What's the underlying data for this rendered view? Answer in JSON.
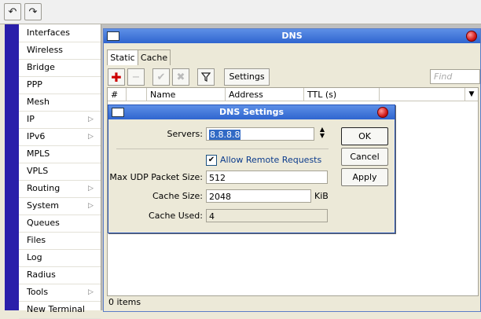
{
  "toolbar": {
    "undo_icon": "undo-icon",
    "redo_icon": "redo-icon"
  },
  "menu": {
    "items": [
      {
        "label": "Interfaces",
        "submenu": false
      },
      {
        "label": "Wireless",
        "submenu": false
      },
      {
        "label": "Bridge",
        "submenu": false
      },
      {
        "label": "PPP",
        "submenu": false
      },
      {
        "label": "Mesh",
        "submenu": false
      },
      {
        "label": "IP",
        "submenu": true
      },
      {
        "label": "IPv6",
        "submenu": true
      },
      {
        "label": "MPLS",
        "submenu": false
      },
      {
        "label": "VPLS",
        "submenu": false
      },
      {
        "label": "Routing",
        "submenu": true
      },
      {
        "label": "System",
        "submenu": true
      },
      {
        "label": "Queues",
        "submenu": false
      },
      {
        "label": "Files",
        "submenu": false
      },
      {
        "label": "Log",
        "submenu": false
      },
      {
        "label": "Radius",
        "submenu": false
      },
      {
        "label": "Tools",
        "submenu": true
      },
      {
        "label": "New Terminal",
        "submenu": false
      }
    ]
  },
  "dns_window": {
    "title": "DNS",
    "tabs": [
      {
        "label": "Static",
        "active": true
      },
      {
        "label": "Cache",
        "active": false
      }
    ],
    "settings_button": "Settings",
    "find_placeholder": "Find",
    "columns": [
      "#",
      "",
      "Name",
      "Address",
      "TTL (s)"
    ],
    "status": "0 items"
  },
  "dns_settings": {
    "title": "DNS Settings",
    "servers_label": "Servers:",
    "servers_value": "8.8.8.8",
    "allow_remote_label": "Allow Remote Requests",
    "allow_remote_checked": true,
    "max_udp_label": "Max UDP Packet Size:",
    "max_udp_value": "512",
    "cache_size_label": "Cache Size:",
    "cache_size_value": "2048",
    "cache_size_unit": "KiB",
    "cache_used_label": "Cache Used:",
    "cache_used_value": "4",
    "ok_label": "OK",
    "cancel_label": "Cancel",
    "apply_label": "Apply"
  },
  "colors": {
    "sidebar_accent": "#2a1faa",
    "titlebar": "#2f65cf",
    "close_button": "#d21d1d",
    "add_icon": "#cc0000"
  }
}
